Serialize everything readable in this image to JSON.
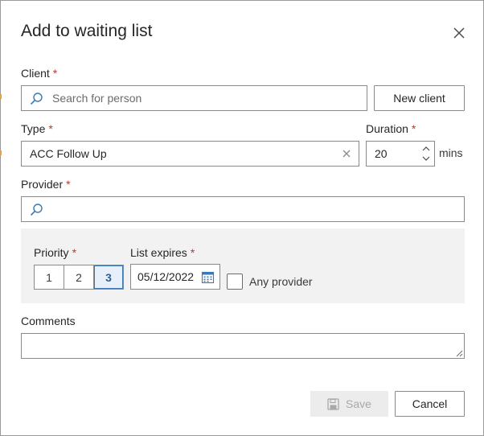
{
  "dialog": {
    "title": "Add to waiting list",
    "close_icon": "close-icon"
  },
  "client": {
    "label": "Client",
    "required_mark": "*",
    "placeholder": "Search for person",
    "value": "",
    "new_client_label": "New client"
  },
  "type": {
    "label": "Type",
    "required_mark": "*",
    "value": "ACC Follow Up"
  },
  "duration": {
    "label": "Duration",
    "required_mark": "*",
    "value": "20",
    "unit": "mins"
  },
  "provider": {
    "label": "Provider",
    "required_mark": "*",
    "value": ""
  },
  "priority": {
    "label": "Priority",
    "required_mark": "*",
    "options": [
      "1",
      "2",
      "3"
    ],
    "selected": "3"
  },
  "list_expires": {
    "label": "List expires",
    "required_mark": "*",
    "value": "05/12/2022"
  },
  "any_provider": {
    "label": "Any provider",
    "checked": false
  },
  "comments": {
    "label": "Comments",
    "value": ""
  },
  "footer": {
    "save_label": "Save",
    "cancel_label": "Cancel"
  },
  "colors": {
    "required": "#c0392b",
    "accent": "#2c5f93",
    "search_icon": "#3c78b4",
    "panel_bg": "#f2f2f2"
  }
}
